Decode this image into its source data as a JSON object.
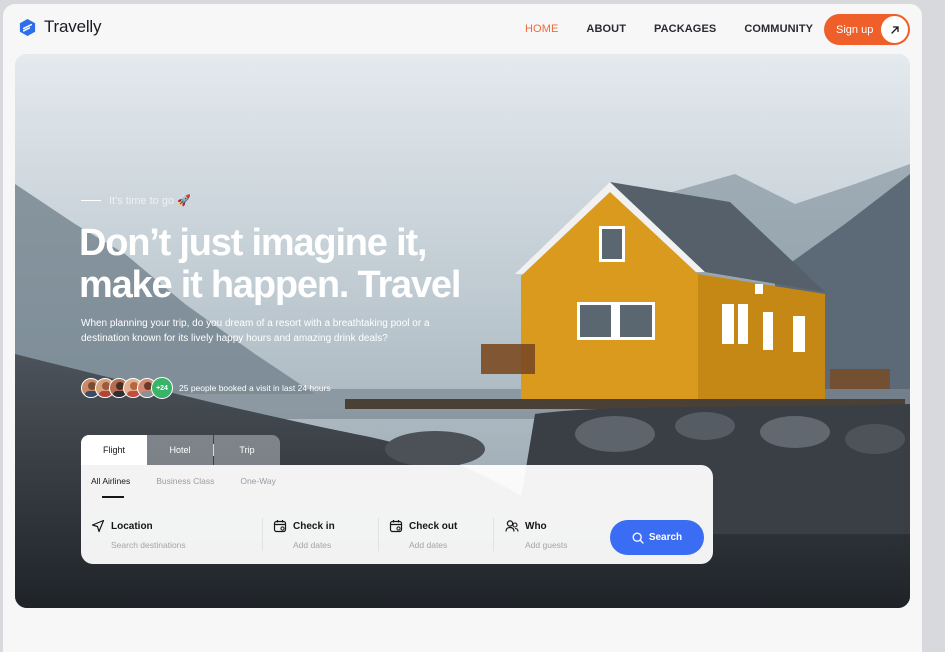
{
  "brand": {
    "name": "Travelly"
  },
  "nav": {
    "links": [
      "HOME",
      "ABOUT",
      "PACKAGES",
      "COMMUNITY"
    ],
    "active_index": 0,
    "signup_label": "Sign up"
  },
  "hero": {
    "eyebrow": "It's time to go 🚀",
    "headline_line1": "Don’t just imagine it,",
    "headline_line2": "make it happen. Travel",
    "subtext": "When planning your trip, do you dream of a resort with a breathtaking pool or a destination known for its lively happy hours and amazing drink deals?",
    "social_count": "+24",
    "social_text": "25 people booked a visit in last 24 hours"
  },
  "booking": {
    "tabs": [
      "Flight",
      "Hotel",
      "Trip"
    ],
    "subtabs": [
      "All Airlines",
      "Business Class",
      "One-Way"
    ],
    "fields": [
      {
        "title": "Location",
        "placeholder": "Search destinations",
        "icon": "navigation-arrow-icon"
      },
      {
        "title": "Check in",
        "placeholder": "Add dates",
        "icon": "calendar-icon"
      },
      {
        "title": "Check out",
        "placeholder": "Add dates",
        "icon": "calendar-icon"
      },
      {
        "title": "Who",
        "placeholder": "Add guests",
        "icon": "users-icon"
      }
    ],
    "search_label": "Search"
  },
  "colors": {
    "accent": "#ee5f2a",
    "primary": "#3a6cf4",
    "success": "#39b26a"
  }
}
